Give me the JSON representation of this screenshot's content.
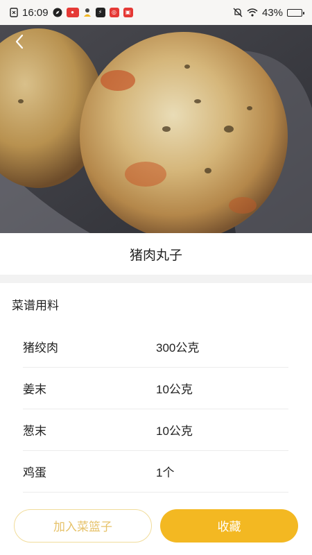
{
  "status_bar": {
    "time": "16:09",
    "battery_text": "43%",
    "battery_level": 0.43,
    "icons": [
      "sim-card-icon",
      "compass-icon",
      "app-badge-icon",
      "person-icon",
      "flash-app-icon",
      "red-app-icon",
      "red-app-icon-2",
      "mute-icon",
      "wifi-icon",
      "battery-icon"
    ]
  },
  "recipe": {
    "title": "猪肉丸子"
  },
  "ingredients_section": {
    "heading": "菜谱用料",
    "items": [
      {
        "name": "猪绞肉",
        "qty": "300公克"
      },
      {
        "name": "姜末",
        "qty": "10公克"
      },
      {
        "name": "葱末",
        "qty": "10公克"
      },
      {
        "name": "鸡蛋",
        "qty": "1个"
      }
    ]
  },
  "actions": {
    "add_basket": "加入菜篮子",
    "favorite": "收藏"
  },
  "colors": {
    "accent": "#f3b822",
    "accent_light": "#f1dc9a",
    "underline": "#f3c033"
  }
}
